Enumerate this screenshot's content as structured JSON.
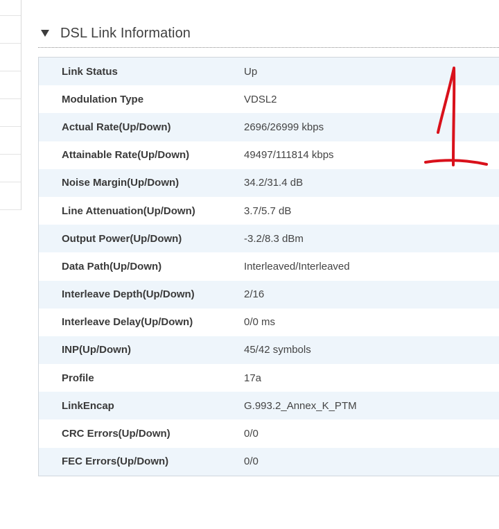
{
  "section": {
    "title": "DSL Link Information"
  },
  "rows": [
    {
      "label": "Link Status",
      "value": "Up"
    },
    {
      "label": "Modulation Type",
      "value": "VDSL2"
    },
    {
      "label": "Actual Rate(Up/Down)",
      "value": "2696/26999 kbps"
    },
    {
      "label": "Attainable Rate(Up/Down)",
      "value": "49497/111814 kbps"
    },
    {
      "label": "Noise Margin(Up/Down)",
      "value": "34.2/31.4 dB"
    },
    {
      "label": "Line Attenuation(Up/Down)",
      "value": "3.7/5.7 dB"
    },
    {
      "label": "Output Power(Up/Down)",
      "value": "-3.2/8.3 dBm"
    },
    {
      "label": "Data Path(Up/Down)",
      "value": "Interleaved/Interleaved"
    },
    {
      "label": "Interleave Depth(Up/Down)",
      "value": "2/16"
    },
    {
      "label": "Interleave Delay(Up/Down)",
      "value": "0/0 ms"
    },
    {
      "label": "INP(Up/Down)",
      "value": "45/42 symbols"
    },
    {
      "label": "Profile",
      "value": "17a"
    },
    {
      "label": "LinkEncap",
      "value": "G.993.2_Annex_K_PTM"
    },
    {
      "label": "CRC Errors(Up/Down)",
      "value": "0/0"
    },
    {
      "label": "FEC Errors(Up/Down)",
      "value": "0/0"
    }
  ],
  "colors": {
    "row_odd": "#eef5fb",
    "row_even": "#ffffff",
    "annotation": "#d9111b"
  },
  "icons": {
    "toggle": "triangle-down-icon"
  }
}
